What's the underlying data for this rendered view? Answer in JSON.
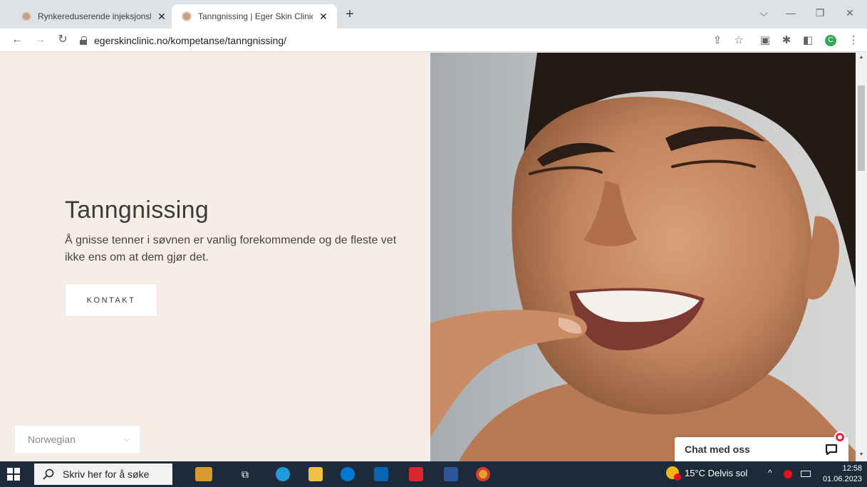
{
  "browser": {
    "tabs": [
      {
        "title": "Rynkereduserende injeksjonsbeh",
        "active": false
      },
      {
        "title": "Tanngnissing | Eger Skin Clinic",
        "active": true
      }
    ],
    "url": "egerskinclinic.no/kompetanse/tanngnissing/",
    "profile_initial": "C"
  },
  "page": {
    "hero_title": "Tanngnissing",
    "hero_text": "Å gnisse tenner i søvnen er vanlig forekommende og de fleste vet ikke ens om at dem gjør det.",
    "contact_button": "KONTAKT",
    "language_select": {
      "selected": "Norwegian"
    },
    "chat_label": "Chat med oss"
  },
  "taskbar": {
    "search_placeholder": "Skriv her for å søke",
    "weather": "15°C  Delvis sol",
    "time": "12:58",
    "date": "01.06.2023"
  },
  "colors": {
    "page_background": "#f6ede7",
    "taskbar": "#1c2a3a",
    "chat_badge": "#e8233d"
  }
}
